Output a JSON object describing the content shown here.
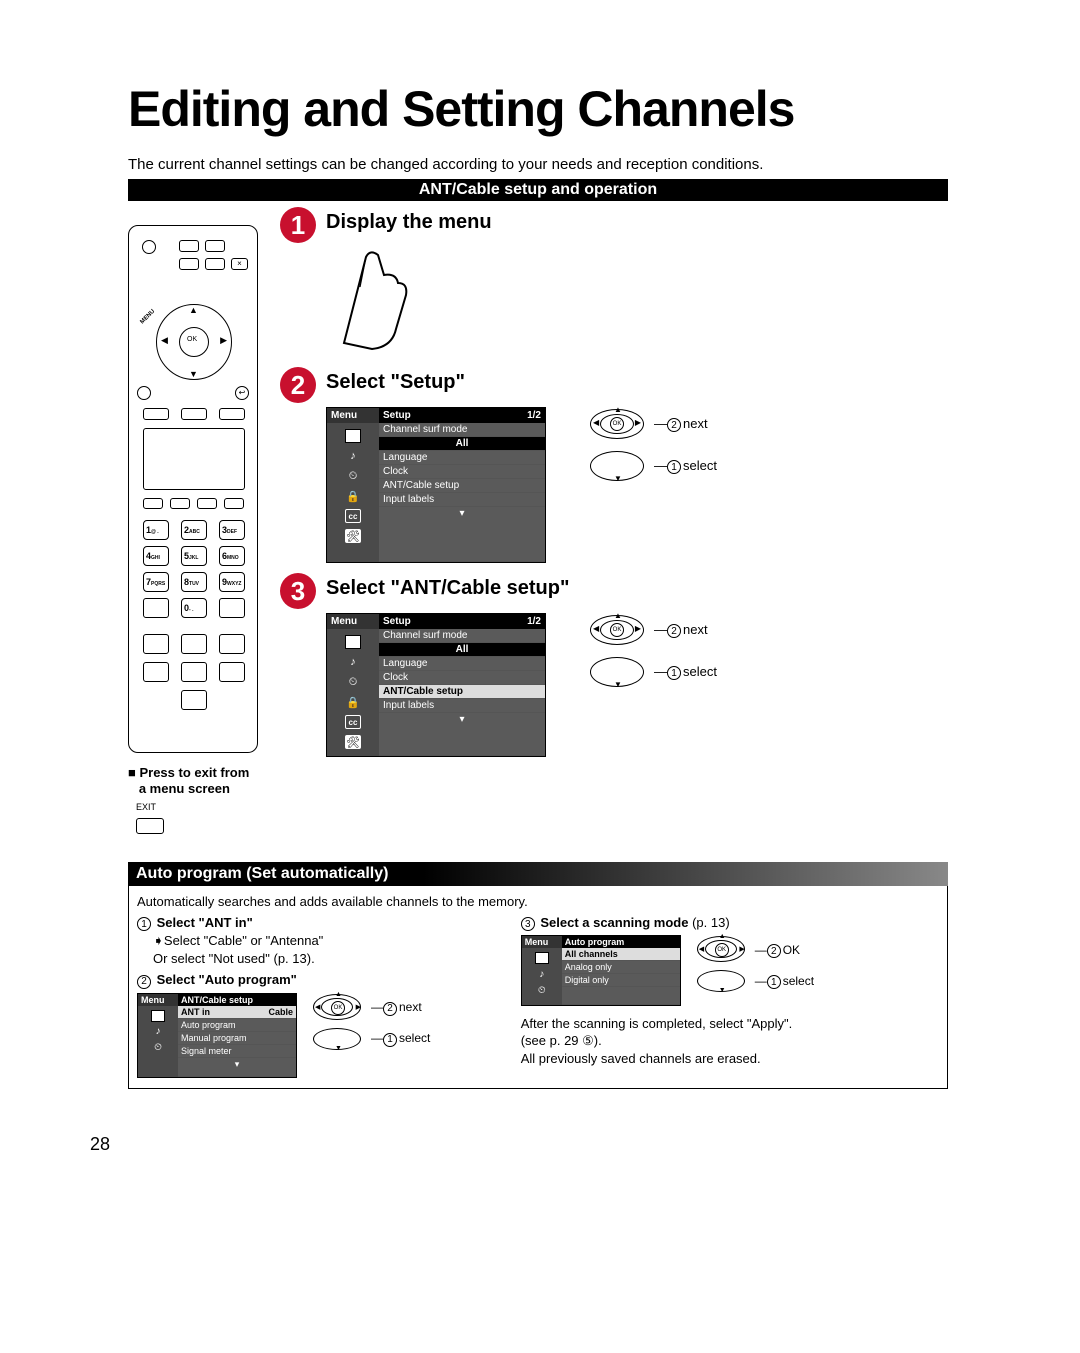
{
  "title": "Editing and Setting Channels",
  "intro": "The current channel settings can be changed according to your needs and reception conditions.",
  "bar1": "ANT/Cable setup and operation",
  "remote": {
    "menu_label": "MENU",
    "ok": "OK",
    "keys": {
      "k1": "1",
      "k1s": "@ .",
      "k2": "2",
      "k2s": "ABC",
      "k3": "3",
      "k3s": "DEF",
      "k4": "4",
      "k4s": "GHI",
      "k5": "5",
      "k5s": "JKL",
      "k6": "6",
      "k6s": "MNO",
      "k7": "7",
      "k7s": "PQRS",
      "k8": "8",
      "k8s": "TUV",
      "k9": "9",
      "k9s": "WXYZ",
      "k0": "0",
      "k0s": "- ."
    }
  },
  "exit": {
    "heading_a": "Press to exit from",
    "heading_b": "a menu screen",
    "label": "EXIT"
  },
  "steps": {
    "s1": {
      "n": "1",
      "title": "Display the menu"
    },
    "s2": {
      "n": "2",
      "title": "Select \"Setup\""
    },
    "s3": {
      "n": "3",
      "title": "Select \"ANT/Cable setup\""
    }
  },
  "osd": {
    "menu": "Menu",
    "tab": "Setup",
    "page": "1/2",
    "items": {
      "surf": "Channel surf mode",
      "all": "All",
      "lang": "Language",
      "clock": "Clock",
      "ant": "ANT/Cable setup",
      "input": "Input labels"
    },
    "icons": {
      "pic": "▭",
      "note": "♪",
      "timer": "⏲",
      "lock": "🔒",
      "cc": "cc",
      "tool": "🛠"
    }
  },
  "dpad": {
    "ok": "OK",
    "next": "next",
    "select": "select",
    "okword": "OK"
  },
  "auto": {
    "bar": "Auto program (Set automatically)",
    "desc": "Automatically searches and adds available channels to the memory.",
    "s1": {
      "head": "Select \"ANT in\"",
      "l1": "Select \"Cable\" or \"Antenna\"",
      "l2": "Or select \"Not used\" (p. 13)."
    },
    "s2": {
      "head": "Select \"Auto program\""
    },
    "s3": {
      "head": "Select a scanning mode",
      "ref": "(p. 13)"
    },
    "after1": "After the scanning is completed, select \"Apply\".",
    "after2": "(see p. 29 ⑤).",
    "after3": "All previously saved channels are erased."
  },
  "osd_ant": {
    "menu": "Menu",
    "tab": "ANT/Cable setup",
    "items": {
      "antin": "ANT in",
      "cable": "Cable",
      "auto": "Auto program",
      "manual": "Manual program",
      "signal": "Signal meter"
    }
  },
  "osd_auto": {
    "menu": "Menu",
    "tab": "Auto program",
    "items": {
      "all": "All channels",
      "analog": "Analog only",
      "digital": "Digital only"
    }
  },
  "pagenum": "28"
}
